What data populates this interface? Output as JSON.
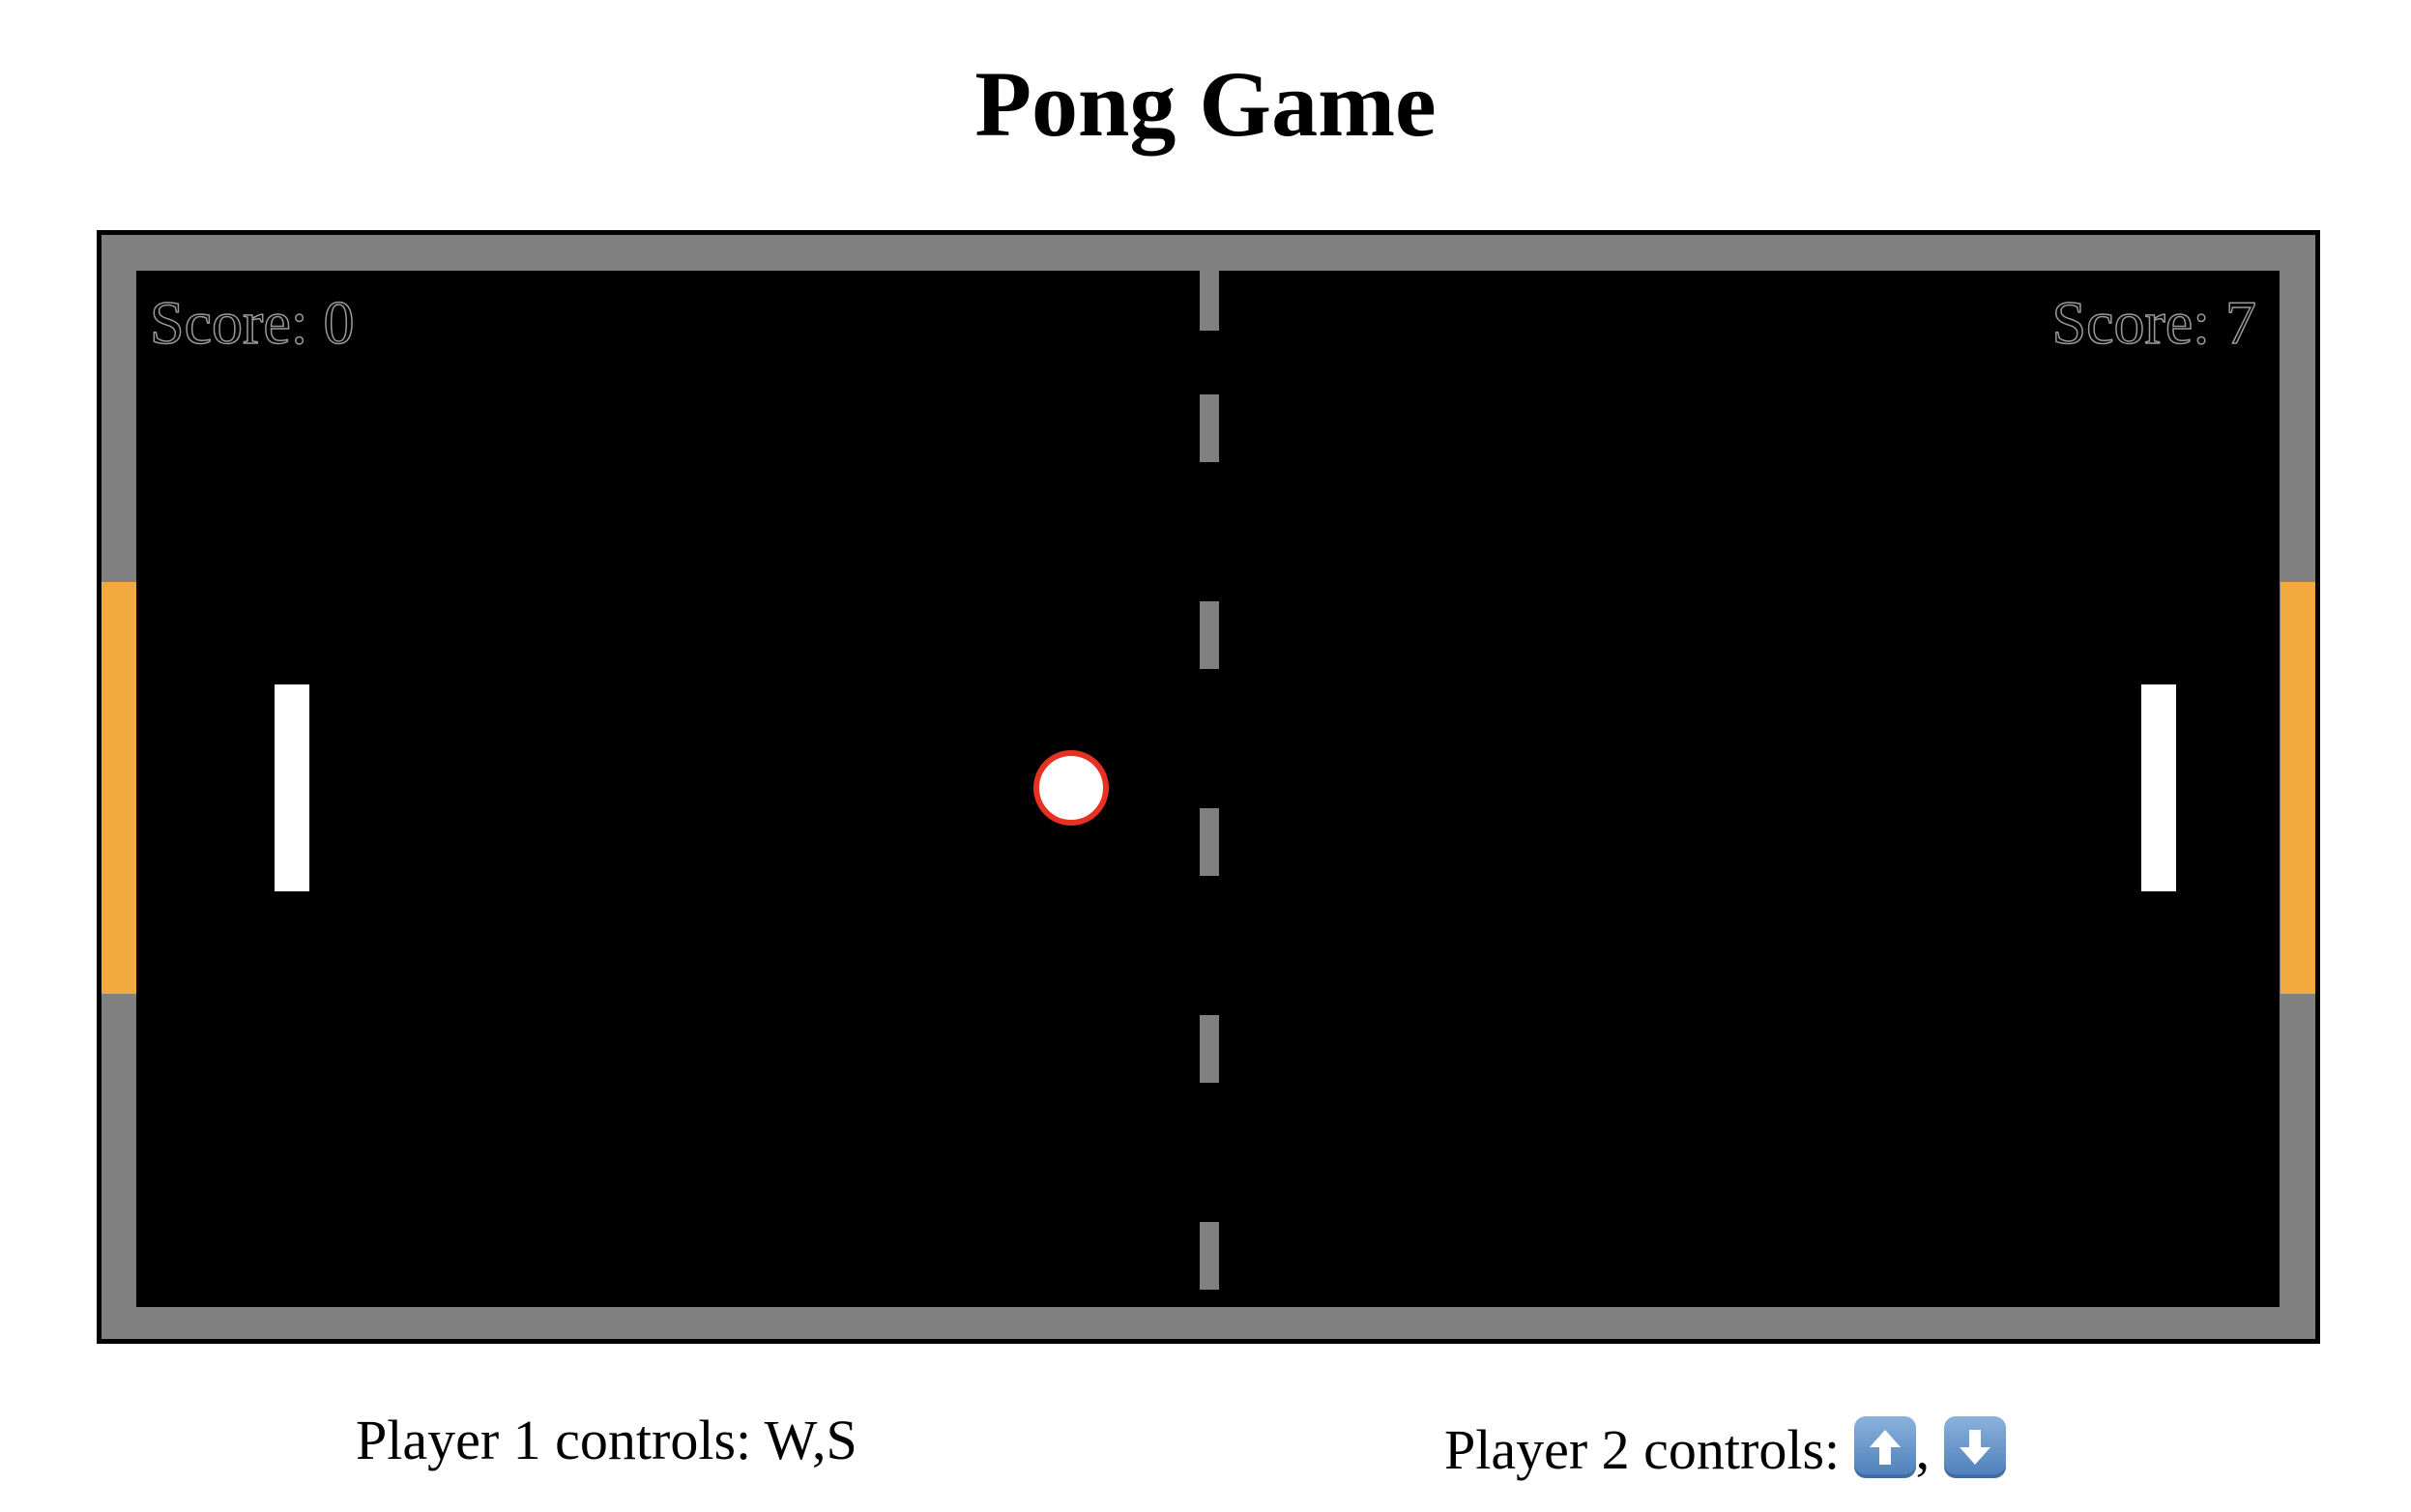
{
  "page": {
    "title": "Pong Game"
  },
  "game": {
    "player1": {
      "score_label": "Score: 0",
      "score": 0
    },
    "player2": {
      "score_label": "Score: 7",
      "score": 7
    },
    "colors": {
      "frame": "#808080",
      "court": "#000000",
      "goal": "#f2aa40",
      "paddle": "#ffffff",
      "ball_fill": "#ffffff",
      "ball_outline": "#e53222",
      "center_line": "#808080"
    }
  },
  "controls": {
    "player1_text": "Player 1 controls: W,S",
    "player2_prefix": "Player 2 controls: ",
    "player2_separator": ",",
    "player2_keys": [
      "up-arrow-icon",
      "down-arrow-icon"
    ]
  }
}
